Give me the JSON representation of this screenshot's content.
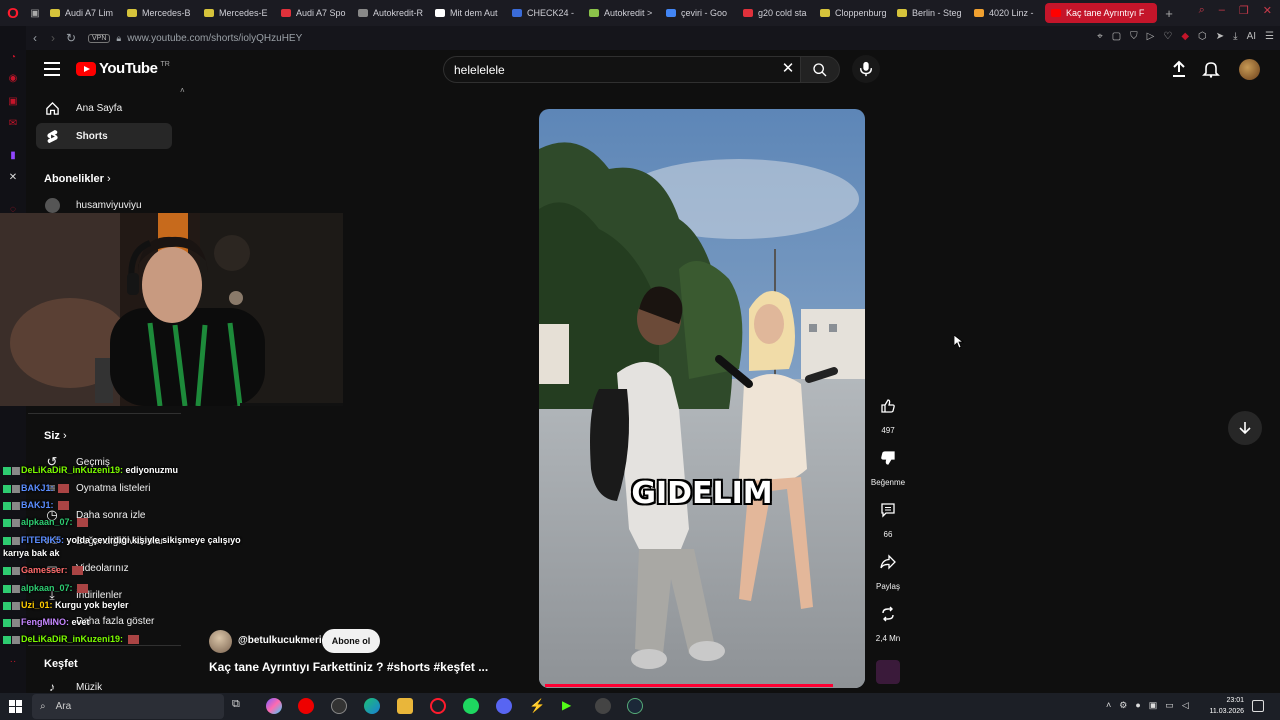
{
  "browser": {
    "tabs": [
      {
        "label": "Audi A7 Lim",
        "color": "#d6c33b"
      },
      {
        "label": "Mercedes-B",
        "color": "#d6c33b"
      },
      {
        "label": "Mercedes-E",
        "color": "#d6c33b"
      },
      {
        "label": "Audi A7 Spo",
        "color": "#e0313b"
      },
      {
        "label": "Autokredit-R",
        "color": "#888888"
      },
      {
        "label": "Mit dem Aut",
        "color": "#ffffff"
      },
      {
        "label": "CHECK24 -",
        "color": "#3a6bd8"
      },
      {
        "label": "Autokredit >",
        "color": "#8bc34a"
      },
      {
        "label": "çeviri - Goo",
        "color": "#4285f4"
      },
      {
        "label": "g20 cold sta",
        "color": "#e0313b"
      },
      {
        "label": "Cloppenburg",
        "color": "#d6c33b"
      },
      {
        "label": "Berlin - Steg",
        "color": "#d6c33b"
      },
      {
        "label": "4020 Linz -",
        "color": "#f0a030"
      },
      {
        "label": "Kaç tane Ayrıntıyı F",
        "color": "#ff0000",
        "active": true
      }
    ],
    "url": "www.youtube.com/shorts/iolyQHzuHEY",
    "vpn_label": "VPN",
    "ai_label": "AI"
  },
  "youtube": {
    "logo_text": "YouTube",
    "logo_sup": "TR",
    "search": {
      "value": "helelelele"
    },
    "sidebar": {
      "home": "Ana Sayfa",
      "shorts": "Shorts",
      "subscriptions_header": "Abonelikler",
      "subscription_channel": "husamviyuviyu",
      "you_header": "Siz",
      "history": "Geçmiş",
      "playlists": "Oynatma listeleri",
      "watch_later": "Daha sonra izle",
      "liked": "Beğendiğin videolar",
      "your_videos": "Videolarınız",
      "downloads": "İndirilenler",
      "show_more": "Daha fazla göster",
      "explore_header": "Keşfet",
      "music": "Müzik"
    },
    "short": {
      "caption": "GIDELIM",
      "channel": "@betulkucukmeric",
      "subscribe": "Abone ol",
      "title": "Kaç tane Ayrıntıyı Farkettiniz ? #shorts #keşfet ...",
      "likes": "497",
      "dislike_label": "Beğenme",
      "comments": "66",
      "share_label": "Paylaş",
      "remix_count": "2,4 Mn",
      "progress": 0.94
    }
  },
  "chat": [
    {
      "user": "DeLiKaDiR_inKuzeni19:",
      "msg": "ediyonuzmu",
      "color": "#7cfc00"
    },
    {
      "user": "BAKJ1:",
      "msg": "",
      "color": "#5b8dff"
    },
    {
      "user": "BAKJ1:",
      "msg": "",
      "color": "#5b8dff"
    },
    {
      "user": "alpkaan_07:",
      "msg": "",
      "color": "#2ecc71"
    },
    {
      "user": "FITERIK5:",
      "msg": "yolda çevirdiği kişiyle sikişmeye çalışıyo",
      "color": "#5b8dff"
    },
    {
      "user": "",
      "msg": "karıya bak ak",
      "color": "#ffffff"
    },
    {
      "user": "Gamesser:",
      "msg": "",
      "color": "#ff6b6b"
    },
    {
      "user": "alpkaan_07:",
      "msg": "",
      "color": "#2ecc71"
    },
    {
      "user": "Uzi_01:",
      "msg": "Kurgu yok beyler",
      "color": "#ffcc00"
    },
    {
      "user": "FengMINO:",
      "msg": "evet",
      "color": "#c586ff"
    },
    {
      "user": "DeLiKaDiR_inKuzeni19:",
      "msg": "",
      "color": "#7cfc00"
    }
  ],
  "taskbar": {
    "search_placeholder": "Ara",
    "time": "23:01",
    "date": "11.03.2026"
  }
}
